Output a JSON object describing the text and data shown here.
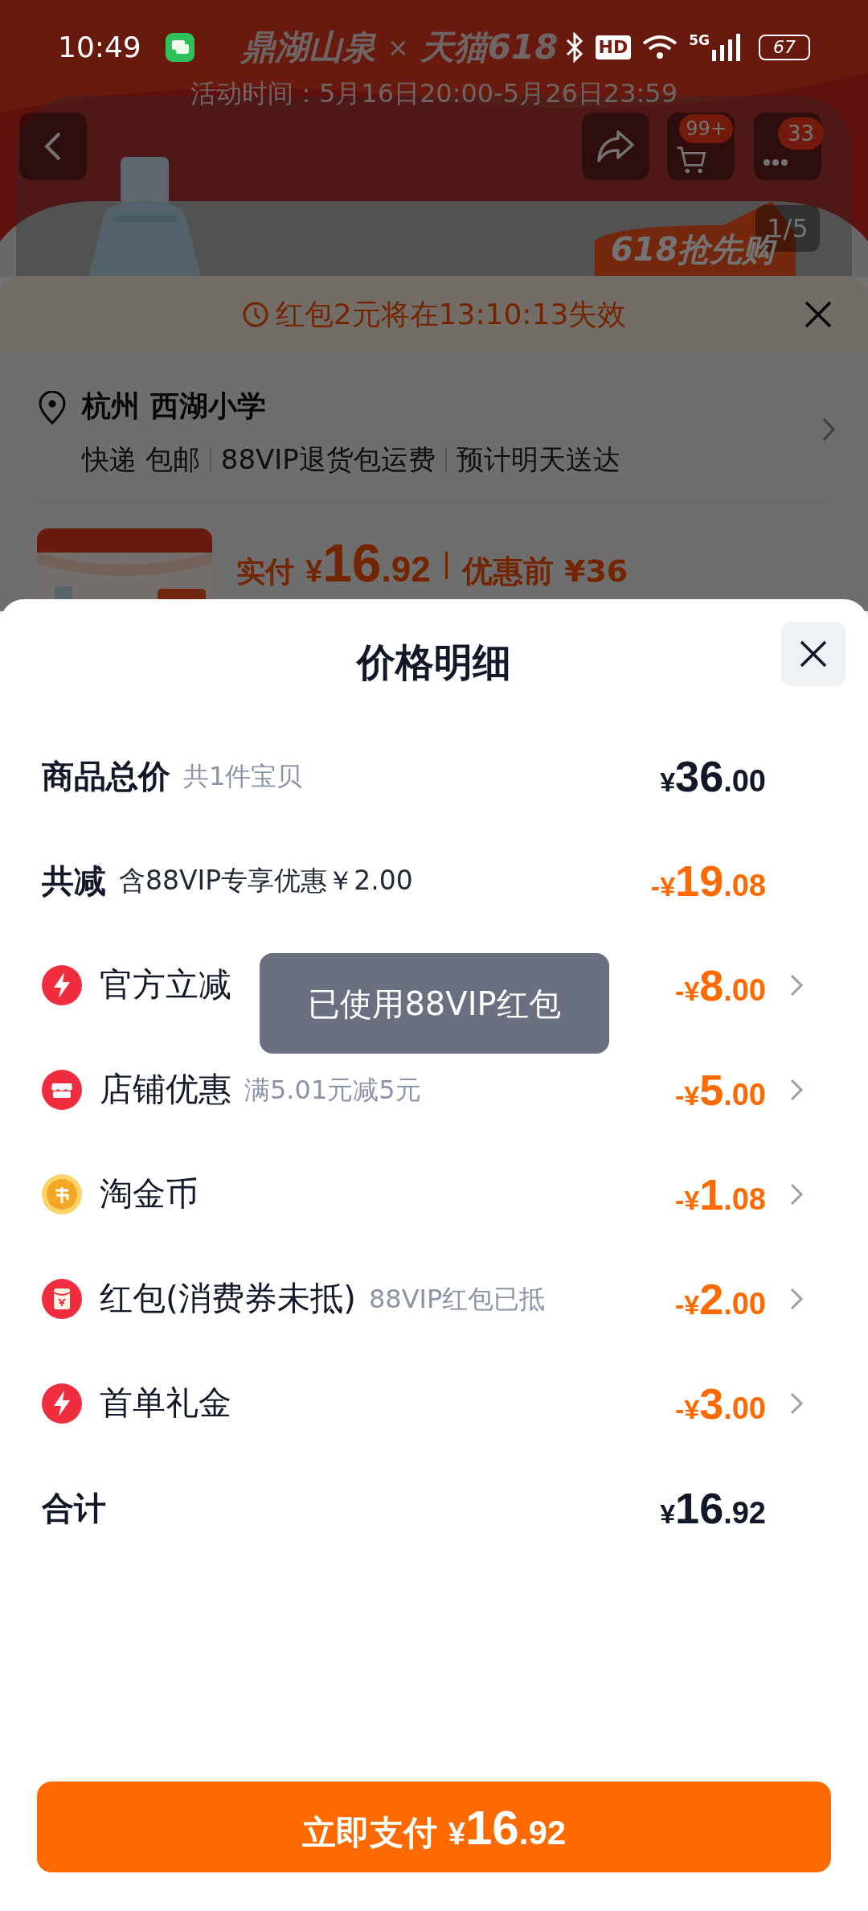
{
  "status_bar": {
    "time": "10:49",
    "hd": "HD",
    "network": "5G",
    "battery": "67"
  },
  "banner": {
    "brand": "鼎湖山泉",
    "separator": "×",
    "partner": "天猫618",
    "activity_time": "活动时间：5月16日20:00-5月26日23:59",
    "promo": "618抢先购"
  },
  "nav": {
    "cart_badge": "99+",
    "message_badge": "33",
    "image_counter": "1/5"
  },
  "checkout": {
    "countdown": "红包2元将在13:10:13失效",
    "address": {
      "place": "杭州 西湖小学",
      "delivery": [
        "快递 包邮",
        "88VIP退货包运费",
        "预计明天送达"
      ]
    },
    "product": {
      "paid_label": "实付",
      "paid": {
        "symbol": "¥",
        "integer": "16",
        "decimal": ".92"
      },
      "before": "优惠前 ¥36"
    }
  },
  "sheet": {
    "title": "价格明细",
    "rows": [
      {
        "kind": "header",
        "label": "商品总价",
        "note": "共1件宝贝",
        "note_emphasis": false,
        "discount": false,
        "amount": {
          "symbol": "¥",
          "integer": "36",
          "decimal": ".00"
        }
      },
      {
        "kind": "header",
        "label": "共减",
        "note": "含88VIP专享优惠￥2.00",
        "note_emphasis": true,
        "discount": true,
        "amount": {
          "sign": "-",
          "symbol": "¥",
          "integer": "19",
          "decimal": ".08"
        }
      },
      {
        "kind": "bolt",
        "label": "官方立减",
        "discount": true,
        "amount": {
          "sign": "-",
          "symbol": "¥",
          "integer": "8",
          "decimal": ".00"
        }
      },
      {
        "kind": "shop",
        "label": "店铺优惠",
        "note": "满5.01元减5元",
        "note_emphasis": false,
        "discount": true,
        "amount": {
          "sign": "-",
          "symbol": "¥",
          "integer": "5",
          "decimal": ".00"
        }
      },
      {
        "kind": "coin",
        "label": "淘金币",
        "discount": true,
        "amount": {
          "sign": "-",
          "symbol": "¥",
          "integer": "1",
          "decimal": ".08"
        }
      },
      {
        "kind": "envelope",
        "label": "红包(消费券未抵)",
        "note": "88VIP红包已抵",
        "note_emphasis": false,
        "discount": true,
        "amount": {
          "sign": "-",
          "symbol": "¥",
          "integer": "2",
          "decimal": ".00"
        }
      },
      {
        "kind": "bolt",
        "label": "首单礼金",
        "discount": true,
        "amount": {
          "sign": "-",
          "symbol": "¥",
          "integer": "3",
          "decimal": ".00"
        }
      },
      {
        "kind": "header",
        "label": "合计",
        "discount": false,
        "amount": {
          "symbol": "¥",
          "integer": "16",
          "decimal": ".92"
        }
      }
    ],
    "toast": "已使用88VIP红包",
    "pay_button": {
      "label": "立即支付",
      "amount": {
        "symbol": "¥",
        "integer": "16",
        "decimal": ".92"
      }
    }
  }
}
